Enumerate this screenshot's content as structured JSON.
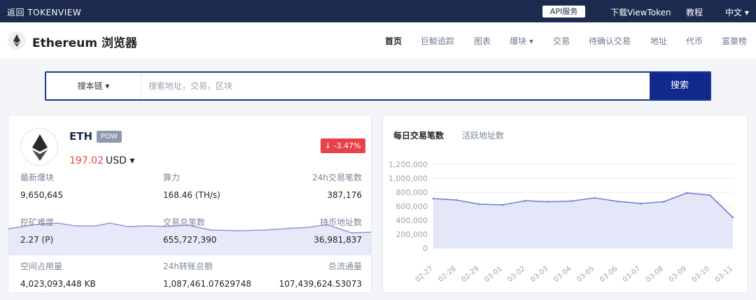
{
  "topbar": {
    "back": "返回 TOKENVIEW",
    "api": "API服务",
    "download": "下载ViewToken",
    "tutorial": "教程",
    "lang": "中文 ▾"
  },
  "header": {
    "brand": "Ethereum 浏览器",
    "nav": [
      "首页",
      "巨鲸追踪",
      "图表",
      "爆块 ▾",
      "交易",
      "待确认交易",
      "地址",
      "代币",
      "富豪榜"
    ]
  },
  "search": {
    "scope": "搜本链 ▾",
    "placeholder": "搜索地址，交易，区块",
    "button": "搜索"
  },
  "coin": {
    "symbol": "ETH",
    "badge": "POW",
    "price": "197.02",
    "unit": "USD ▾",
    "change": "↓ -3.47%"
  },
  "stats": [
    {
      "label": "最新爆块",
      "value": "9,650,645"
    },
    {
      "label": "算力",
      "value": "168.46 (TH/s)"
    },
    {
      "label": "24h交易笔数",
      "value": "387,176"
    },
    {
      "label": "挖矿难度",
      "value": "2.27 (P)"
    },
    {
      "label": "交易总笔数",
      "value": "655,727,390"
    },
    {
      "label": "持币地址数",
      "value": "36,981,837"
    },
    {
      "label": "空间占用量",
      "value": "4,023,093,448 KB"
    },
    {
      "label": "24h转账总额",
      "value": "1,087,461.07629748"
    },
    {
      "label": "总流通量",
      "value": "107,439,624.53073"
    }
  ],
  "tabs": {
    "active": "每日交易笔数",
    "other": "活跃地址数"
  },
  "colors": {
    "topbar": "#1b2a4e",
    "button": "#10298a",
    "down": "#e8414a",
    "line": "#6f7fd4",
    "area": "#dfe3f7"
  },
  "chart_data": {
    "type": "area",
    "x": [
      "02-27",
      "02-28",
      "02-29",
      "03-01",
      "03-02",
      "03-03",
      "03-04",
      "03-05",
      "03-06",
      "03-07",
      "03-08",
      "03-09",
      "03-10",
      "03-11"
    ],
    "values": [
      710000,
      690000,
      630000,
      620000,
      680000,
      665000,
      675000,
      720000,
      670000,
      640000,
      665000,
      790000,
      760000,
      440000
    ],
    "ylim": [
      0,
      1200000
    ],
    "yticks": [
      "0",
      "200,000",
      "400,000",
      "600,000",
      "800,000",
      "1,000,000",
      "1,200,000"
    ],
    "grid": true
  }
}
